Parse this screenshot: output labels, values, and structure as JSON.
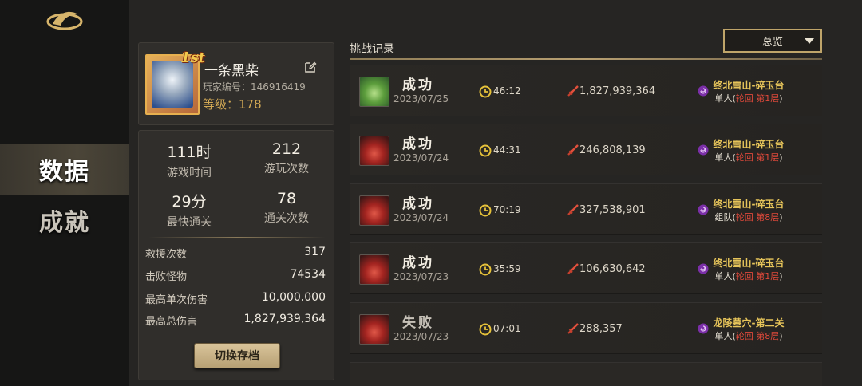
{
  "nav": {
    "data_label": "数据",
    "achievement_label": "成就"
  },
  "profile": {
    "rank_badge": "1st",
    "name": "一条黑柴",
    "id_label": "玩家编号：",
    "id_value": "146916419",
    "level_label": "等级：",
    "level_value": "178"
  },
  "stats": {
    "grid": [
      {
        "value": "111时",
        "label": "游戏时间"
      },
      {
        "value": "212",
        "label": "游玩次数"
      },
      {
        "value": "29分",
        "label": "最快通关"
      },
      {
        "value": "78",
        "label": "通关次数"
      }
    ],
    "rows": [
      {
        "label": "救援次数",
        "value": "317"
      },
      {
        "label": "击败怪物",
        "value": "74534"
      },
      {
        "label": "最高单次伤害",
        "value": "10,000,000"
      },
      {
        "label": "最高总伤害",
        "value": "1,827,939,364"
      }
    ],
    "switch_button": "切换存档"
  },
  "records": {
    "title": "挑战记录",
    "filter": "总览",
    "items": [
      {
        "result": "成功",
        "date": "2023/07/25",
        "time": "46:12",
        "damage": "1,827,939,364",
        "stage": "终北雪山-碎玉台",
        "mode_a": "单人(",
        "mode_b": "轮回 第1层",
        "mode_c": ")",
        "thumb": "green",
        "fail": false
      },
      {
        "result": "成功",
        "date": "2023/07/24",
        "time": "44:31",
        "damage": "246,808,139",
        "stage": "终北雪山-碎玉台",
        "mode_a": "单人(",
        "mode_b": "轮回 第1层",
        "mode_c": ")",
        "thumb": "red",
        "fail": false
      },
      {
        "result": "成功",
        "date": "2023/07/24",
        "time": "70:19",
        "damage": "327,538,901",
        "stage": "终北雪山-碎玉台",
        "mode_a": "组队(",
        "mode_b": "轮回 第8层",
        "mode_c": ")",
        "thumb": "red",
        "fail": false
      },
      {
        "result": "成功",
        "date": "2023/07/23",
        "time": "35:59",
        "damage": "106,630,642",
        "stage": "终北雪山-碎玉台",
        "mode_a": "单人(",
        "mode_b": "轮回 第1层",
        "mode_c": ")",
        "thumb": "red",
        "fail": false
      },
      {
        "result": "失败",
        "date": "2023/07/23",
        "time": "07:01",
        "damage": "288,357",
        "stage": "龙陵墓穴-第二关",
        "mode_a": "单人(",
        "mode_b": "轮回 第8层",
        "mode_c": ")",
        "thumb": "red",
        "fail": true
      }
    ]
  },
  "colors": {
    "accent_gold": "#e6c45a",
    "mode_red": "#e0493b",
    "button": "#d9c49a"
  }
}
